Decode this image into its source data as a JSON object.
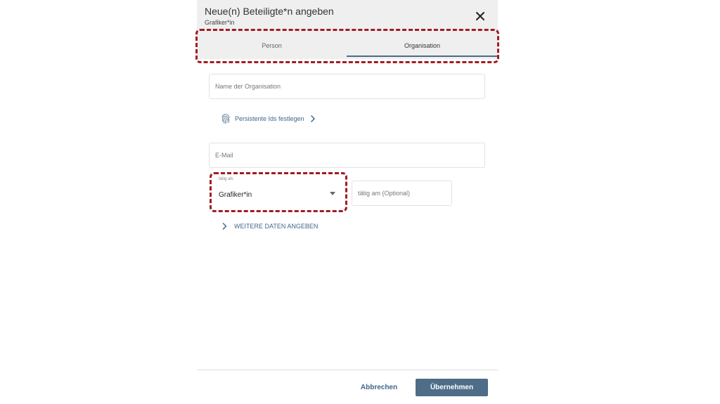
{
  "dialog": {
    "title": "Neue(n) Beteiligte*n angeben",
    "subtitle": "Grafiker*in",
    "close_icon": "close-icon"
  },
  "tabs": [
    {
      "label": "Person",
      "active": false
    },
    {
      "label": "Organisation",
      "active": true
    }
  ],
  "form": {
    "org_name_placeholder": "Name der Organisation",
    "persistent_ids_label": "Persistente Ids festlegen",
    "persistent_ids_icon": "fingerprint-icon",
    "email_placeholder": "E-Mail",
    "role_select": {
      "label": "tätig als",
      "value": "Grafiker*in"
    },
    "date_placeholder": "tätig am (Optional)",
    "more_data_label": "WEITERE DATEN ANGEBEN"
  },
  "footer": {
    "cancel_label": "Abbrechen",
    "apply_label": "Übernehmen"
  },
  "colors": {
    "accent": "#3e6688",
    "primary_button": "#4f6c88",
    "highlight": "#a11c24",
    "header_bg": "#efefef"
  }
}
